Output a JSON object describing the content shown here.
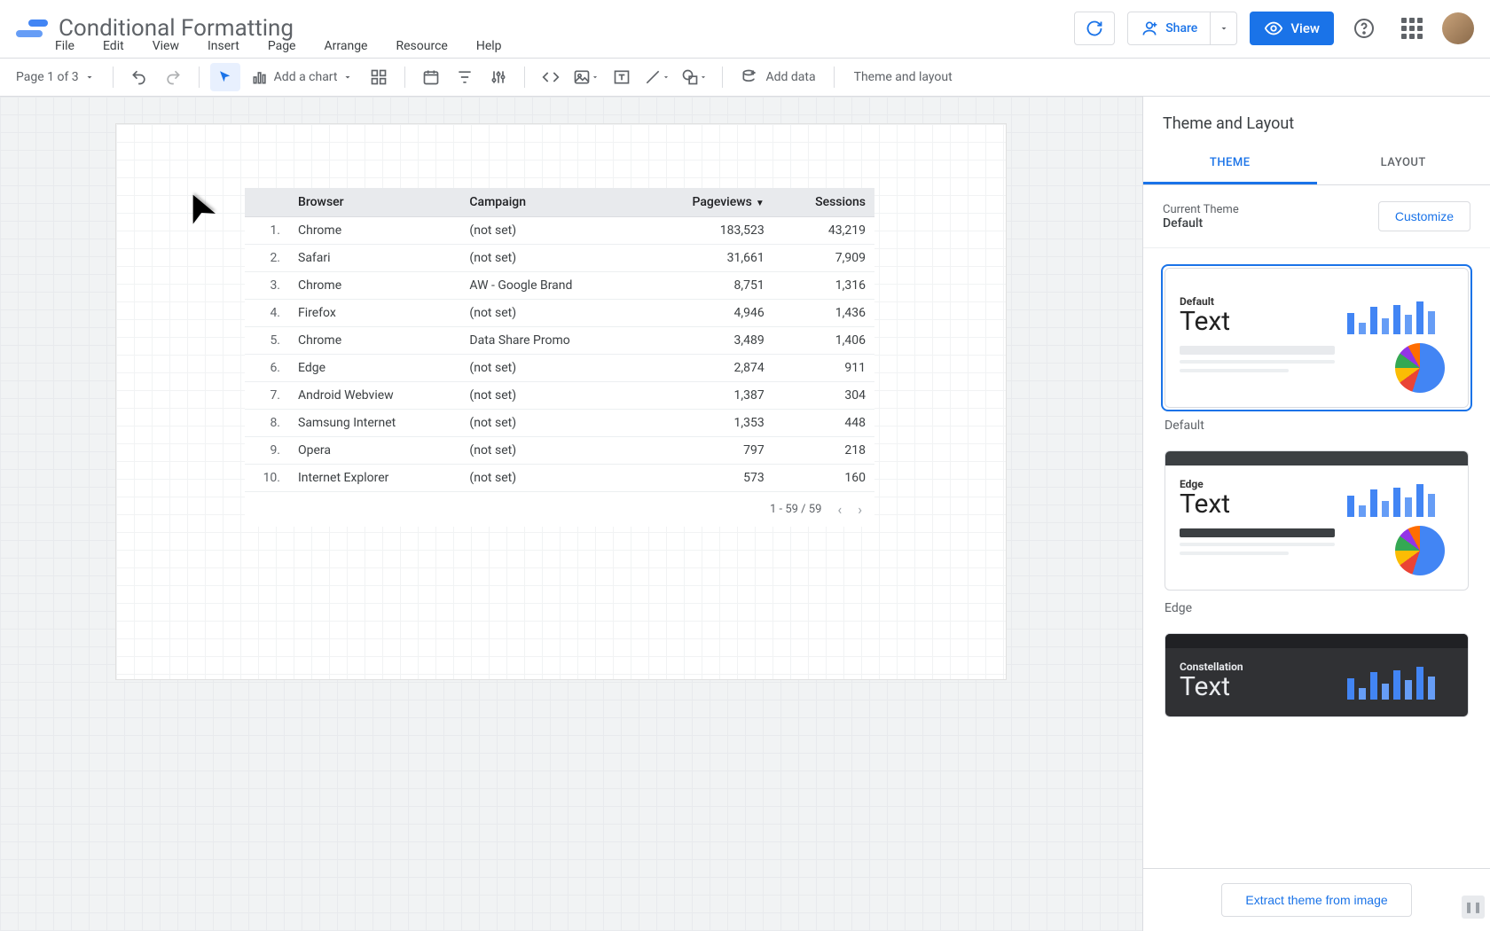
{
  "header": {
    "doc_title": "Conditional Formatting",
    "share_label": "Share",
    "view_label": "View"
  },
  "menubar": [
    "File",
    "Edit",
    "View",
    "Insert",
    "Page",
    "Arrange",
    "Resource",
    "Help"
  ],
  "toolbar": {
    "page_selector": "Page 1 of 3",
    "add_chart": "Add a chart",
    "add_data": "Add data",
    "theme_layout": "Theme and layout"
  },
  "table": {
    "columns": [
      "",
      "Browser",
      "Campaign",
      "Pageviews",
      "Sessions"
    ],
    "sort_column": "Pageviews",
    "rows": [
      {
        "idx": "1.",
        "browser": "Chrome",
        "campaign": "(not set)",
        "pageviews": "183,523",
        "sessions": "43,219"
      },
      {
        "idx": "2.",
        "browser": "Safari",
        "campaign": "(not set)",
        "pageviews": "31,661",
        "sessions": "7,909"
      },
      {
        "idx": "3.",
        "browser": "Chrome",
        "campaign": "AW - Google Brand",
        "pageviews": "8,751",
        "sessions": "1,316"
      },
      {
        "idx": "4.",
        "browser": "Firefox",
        "campaign": "(not set)",
        "pageviews": "4,946",
        "sessions": "1,436"
      },
      {
        "idx": "5.",
        "browser": "Chrome",
        "campaign": "Data Share Promo",
        "pageviews": "3,489",
        "sessions": "1,406"
      },
      {
        "idx": "6.",
        "browser": "Edge",
        "campaign": "(not set)",
        "pageviews": "2,874",
        "sessions": "911"
      },
      {
        "idx": "7.",
        "browser": "Android Webview",
        "campaign": "(not set)",
        "pageviews": "1,387",
        "sessions": "304"
      },
      {
        "idx": "8.",
        "browser": "Samsung Internet",
        "campaign": "(not set)",
        "pageviews": "1,353",
        "sessions": "448"
      },
      {
        "idx": "9.",
        "browser": "Opera",
        "campaign": "(not set)",
        "pageviews": "797",
        "sessions": "218"
      },
      {
        "idx": "10.",
        "browser": "Internet Explorer",
        "campaign": "(not set)",
        "pageviews": "573",
        "sessions": "160"
      }
    ],
    "pager": "1 - 59 / 59"
  },
  "panel": {
    "title": "Theme and Layout",
    "tabs": {
      "theme": "THEME",
      "layout": "LAYOUT"
    },
    "current_label": "Current Theme",
    "current_name": "Default",
    "customize": "Customize",
    "themes": [
      "Default",
      "Edge",
      "Constellation"
    ],
    "extract": "Extract theme from image"
  }
}
